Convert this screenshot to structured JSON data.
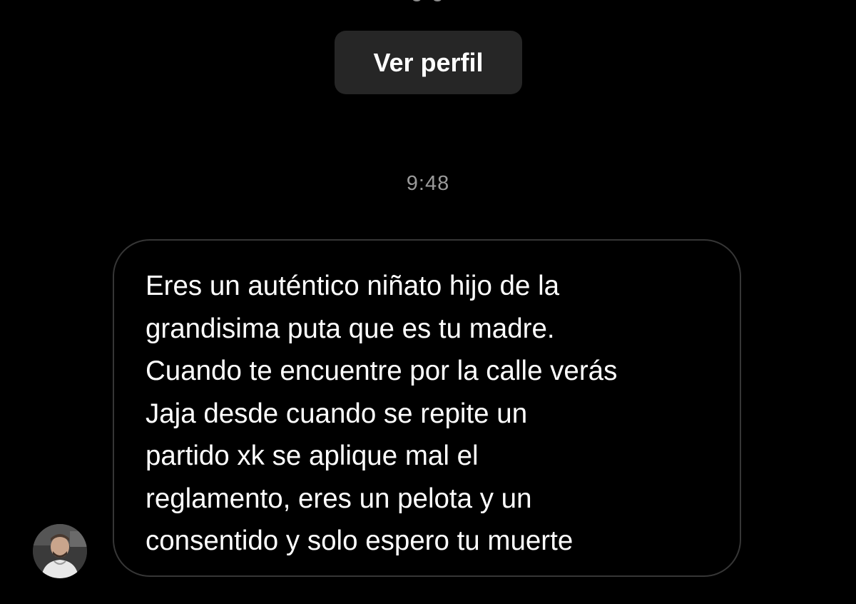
{
  "header": {
    "cutoff_text": "g g"
  },
  "profile_button": {
    "label": "Ver perfil"
  },
  "conversation": {
    "timestamp": "9:48",
    "message": {
      "text": "Eres un auténtico niñato hijo de la\ngrandisima puta que es tu madre.\nCuando te encuentre por la calle verás\nJaja desde cuando se repite un\npartido xk se aplique mal el\nreglamento, eres un pelota y un\nconsentido y solo espero tu muerte"
    },
    "sender_avatar": {
      "icon": "user-avatar"
    }
  },
  "colors": {
    "background": "#000000",
    "button_bg": "#262626",
    "bubble_border": "#363636",
    "timestamp": "#9a9a9a",
    "text": "#ffffff"
  }
}
